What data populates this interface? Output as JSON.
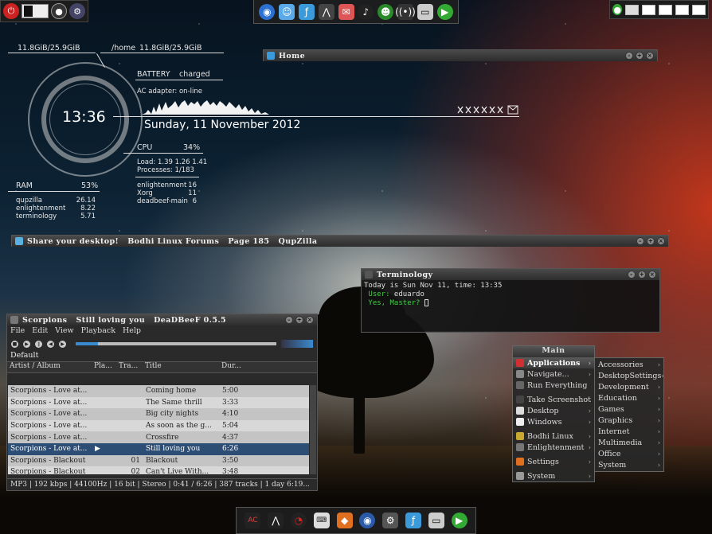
{
  "top_left": {
    "icons": [
      "power-icon",
      "toggle-switch",
      "camera-icon",
      "settings-icon"
    ]
  },
  "top_dock": {
    "icons": [
      "globe-icon",
      "finder-icon",
      "file-manager-icon",
      "terminal-icon",
      "compose-icon",
      "music-icon",
      "pidgin-icon",
      "wifi-icon",
      "screen-icon",
      "play-icon"
    ]
  },
  "top_right": {
    "desktops": [
      "1",
      "2",
      "3",
      "4",
      "5"
    ]
  },
  "conky": {
    "disk_root": "11.8GiB/25.9GiB",
    "home_label": "/home",
    "disk_home": "11.8GiB/25.9GiB",
    "battery_label": "BATTERY",
    "battery_value": "charged",
    "ac_adapter": "AC adapter: on-line",
    "time": "13:36",
    "date": "Sunday, 11 November 2012",
    "cpu_label": "CPU",
    "cpu_value": "34%",
    "load": "Load:  1.39 1.26 1.41",
    "processes": "Processes:      1/183",
    "cpu_procs": [
      {
        "name": "enlightenment",
        "value": "16"
      },
      {
        "name": "Xorg",
        "value": "11"
      },
      {
        "name": "deadbeef-main",
        "value": "6"
      }
    ],
    "ram_label": "RAM",
    "ram_value": "53%",
    "ram_procs": [
      {
        "name": "qupzilla",
        "value": "26.14"
      },
      {
        "name": "enlightenment",
        "value": "8.22"
      },
      {
        "name": "terminology",
        "value": "5.71"
      }
    ]
  },
  "home_window": {
    "title": "Home"
  },
  "qupzilla_window": {
    "title": "Share your desktop!   Bodhi Linux Forums   Page 185   QupZilla"
  },
  "terminology": {
    "title": "Terminology",
    "line1": "Today is Sun Nov 11, time: 13:35",
    "user_prefix": "User:",
    "user_name": " eduardo",
    "prompt": "Yes, Master?"
  },
  "deadbeef": {
    "title": "Scorpions   Still loving you   DeaDBeeF 0.5.5",
    "menu": [
      "File",
      "Edit",
      "View",
      "Playback",
      "Help"
    ],
    "playlist_tab": "Default",
    "columns": [
      "Artist / Album",
      "Pla...",
      "Tra...",
      "Title",
      "Dur..."
    ],
    "rows": [
      {
        "artist": "Scorpions - Love at...",
        "playing": "",
        "track": "",
        "title": "Coming home",
        "dur": "5:00"
      },
      {
        "artist": "Scorpions - Love at...",
        "playing": "",
        "track": "",
        "title": "The Same thrill",
        "dur": "3:33"
      },
      {
        "artist": "Scorpions - Love at...",
        "playing": "",
        "track": "",
        "title": "Big city nights",
        "dur": "4:10"
      },
      {
        "artist": "Scorpions - Love at...",
        "playing": "",
        "track": "",
        "title": "As soon as the g...",
        "dur": "5:04"
      },
      {
        "artist": "Scorpions - Love at...",
        "playing": "",
        "track": "",
        "title": "Crossfire",
        "dur": "4:37"
      },
      {
        "artist": "Scorpions - Love at...",
        "playing": "▶",
        "track": "",
        "title": "Still loving you",
        "dur": "6:26"
      },
      {
        "artist": "Scorpions - Blackout",
        "playing": "",
        "track": "01",
        "title": "Blackout",
        "dur": "3:50"
      },
      {
        "artist": "Scorpions - Blackout",
        "playing": "",
        "track": "02",
        "title": "Can't Live With...",
        "dur": "3:48"
      }
    ],
    "status": "MP3 | 192 kbps | 44100Hz | 16 bit | Stereo | 0:41 / 6:26 | 387 tracks | 1 day 6:19...",
    "progress": 0.11
  },
  "main_menu": {
    "title": "Main",
    "items": [
      {
        "label": "Applications",
        "icon": "applications-icon",
        "color": "#d03030",
        "arrow": "›",
        "selected": true
      },
      {
        "label": "Navigate...",
        "icon": "navigate-icon",
        "color": "#888",
        "arrow": "›"
      },
      {
        "label": "Run Everything",
        "icon": "run-icon",
        "color": "#666",
        "arrow": ""
      },
      {
        "label": "Take Screenshot",
        "icon": "screenshot-icon",
        "color": "#444",
        "arrow": ""
      },
      {
        "label": "Desktop",
        "icon": "desktop-icon",
        "color": "#ddd",
        "arrow": "›"
      },
      {
        "label": "Windows",
        "icon": "windows-icon",
        "color": "#eee",
        "arrow": "›"
      },
      {
        "label": "Bodhi Linux",
        "icon": "bodhi-icon",
        "color": "#c9a832",
        "arrow": "›"
      },
      {
        "label": "Enlightenment",
        "icon": "enlightenment-icon",
        "color": "#777",
        "arrow": "›"
      },
      {
        "label": "Settings",
        "icon": "settings-icon",
        "color": "#e07020",
        "arrow": "›"
      },
      {
        "label": "System",
        "icon": "system-icon",
        "color": "#999",
        "arrow": "›"
      }
    ]
  },
  "apps_menu": {
    "items": [
      "Accessories",
      "DesktopSettings",
      "Development",
      "Education",
      "Games",
      "Graphics",
      "Internet",
      "Multimedia",
      "Office",
      "System"
    ]
  },
  "bottom_dock": {
    "icons": [
      "ac-icon",
      "arch-icon",
      "opera-icon",
      "keyboard-icon",
      "qupzilla-icon",
      "box-icon",
      "settings-icon",
      "finder-icon",
      "screen-icon",
      "play-icon"
    ]
  }
}
